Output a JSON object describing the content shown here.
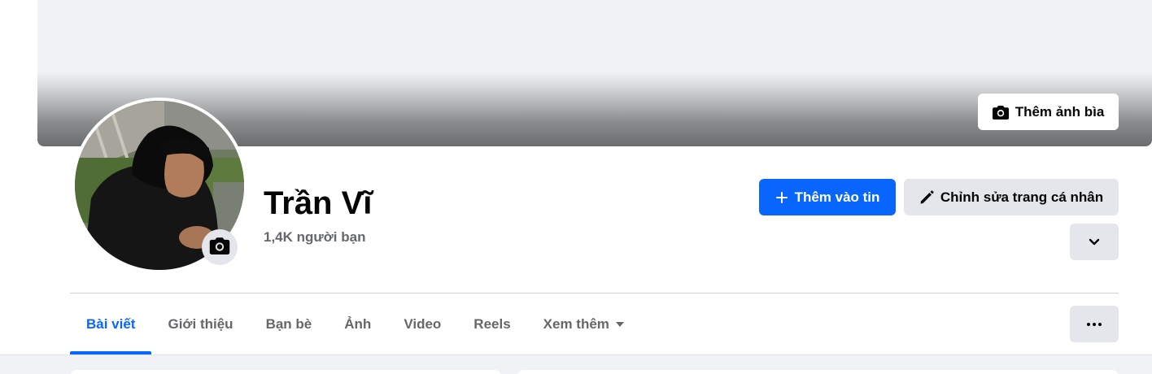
{
  "cover": {
    "add_cover_label": "Thêm ảnh bìa"
  },
  "profile": {
    "name": "Trần Vĩ",
    "friends_count": "1,4K người bạn"
  },
  "actions": {
    "add_story_label": "Thêm vào tin",
    "edit_profile_label": "Chỉnh sửa trang cá nhân"
  },
  "tabs": [
    {
      "label": "Bài viết",
      "active": true
    },
    {
      "label": "Giới thiệu"
    },
    {
      "label": "Bạn bè"
    },
    {
      "label": "Ảnh"
    },
    {
      "label": "Video"
    },
    {
      "label": "Reels"
    },
    {
      "label": "Xem thêm"
    }
  ],
  "colors": {
    "accent": "#0866ff",
    "secondary_button": "#e4e6eb",
    "muted_text": "#65676b"
  },
  "icons": [
    "camera-icon",
    "plus-icon",
    "pencil-icon",
    "chevron-down-icon",
    "more-dots-icon",
    "caret-down-icon"
  ]
}
